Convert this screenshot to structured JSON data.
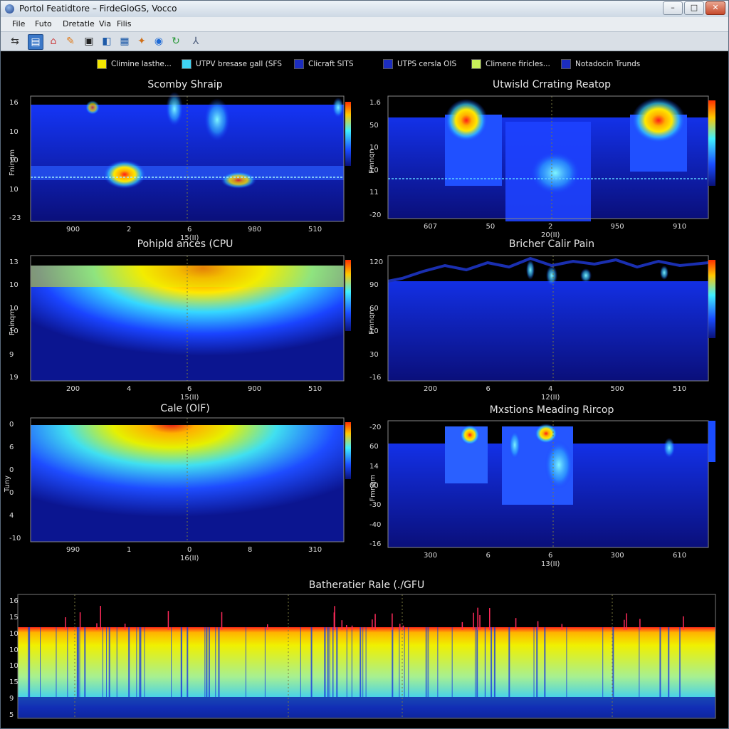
{
  "window": {
    "title": "Portol Featidtore – FirdeGloGS, Vocco"
  },
  "menu": {
    "items": [
      "File",
      "Futo",
      "Dretatle",
      "Via",
      "Filis"
    ]
  },
  "toolbar": {
    "icons": [
      "back-icon",
      "chart-icon",
      "folder-icon",
      "gear-icon",
      "save-icon",
      "export-icon",
      "database-icon",
      "tools-icon",
      "globe-icon",
      "refresh-icon",
      "cursor-icon"
    ]
  },
  "legend": {
    "items": [
      {
        "label": "Climine lasthe...",
        "color": "#f2e600"
      },
      {
        "label": "UTPV bresase gall (SFS",
        "color": "#3fd4f4"
      },
      {
        "label": "Clicraft SITS",
        "color": "#1c2dbf"
      },
      {
        "label": "UTPS cersla OIS",
        "color": "#1c2dbf"
      },
      {
        "label": "Climene firicles...",
        "color": "#c7f05a"
      },
      {
        "label": "Notadocin Trunds",
        "color": "#1c2dbf"
      }
    ]
  },
  "panels": {
    "p1": {
      "title": "Scomby Shraip",
      "yticks": [
        "16",
        "10",
        "10",
        "10",
        "-23"
      ],
      "xticks": [
        "900",
        "2",
        "6",
        "980",
        "510"
      ],
      "xlabel": "15(II)",
      "ylabel": "Fninqm"
    },
    "p2": {
      "title": "Utwisld Crrating Reatop",
      "yticks": [
        "1.6",
        "50",
        "10",
        "10",
        "11",
        "-20"
      ],
      "xticks": [
        "607",
        "50",
        "2",
        "950",
        "910"
      ],
      "xlabel": "20(II)",
      "ylabel": "Fmnqn"
    },
    "p3": {
      "title": "Pohipld ances (CPU",
      "yticks": [
        "13",
        "10",
        "10",
        "10",
        "9",
        "19"
      ],
      "xticks": [
        "200",
        "4",
        "6",
        "900",
        "510"
      ],
      "xlabel": "15(II)",
      "ylabel": "Fninqm"
    },
    "p4": {
      "title": "Bricher Calir Pain",
      "yticks": [
        "120",
        "90",
        "60",
        "10",
        "30",
        "-16"
      ],
      "xticks": [
        "200",
        "6",
        "4",
        "500",
        "510"
      ],
      "xlabel": "12(II)",
      "ylabel": "Fmnqn"
    },
    "p5": {
      "title": "Cale (OIF)",
      "yticks": [
        "0",
        "6",
        "0",
        "0",
        "4",
        "-10"
      ],
      "xticks": [
        "990",
        "1",
        "0",
        "8",
        "310"
      ],
      "xlabel": "16(II)",
      "ylabel": "Tuny"
    },
    "p6": {
      "title": "Mxstions Meading Rircop",
      "yticks": [
        "-20",
        "60",
        "14",
        "00",
        "-30",
        "-40",
        "-16"
      ],
      "xticks": [
        "300",
        "6",
        "6",
        "300",
        "610"
      ],
      "xlabel": "13(II)",
      "ylabel": "Fmnqm"
    },
    "p7": {
      "title": "Batheratier Rale (./GFU",
      "yticks": [
        "16",
        "15",
        "10",
        "10",
        "10",
        "15",
        "9",
        "5"
      ]
    }
  },
  "colors": {
    "background": "#000000",
    "accent": "#1c2dbf"
  }
}
